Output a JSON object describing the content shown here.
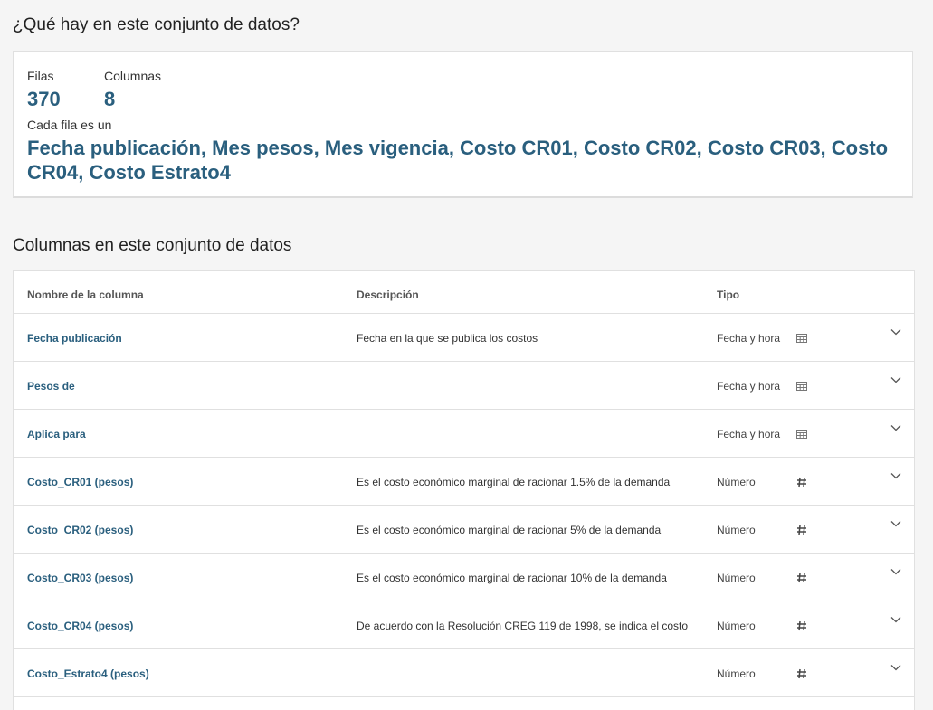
{
  "overview": {
    "title": "¿Qué hay en este conjunto de datos?",
    "rows_label": "Filas",
    "rows_value": "370",
    "columns_label": "Columnas",
    "columns_value": "8",
    "row_desc_label": "Cada fila es un",
    "row_desc_value": "Fecha publicación, Mes pesos, Mes vigencia, Costo CR01, Costo CR02, Costo CR03, Costo CR04, Costo Estrato4"
  },
  "columns_section": {
    "title": "Columnas en este conjunto de datos",
    "headers": {
      "name": "Nombre de la columna",
      "description": "Descripción",
      "type": "Tipo"
    },
    "rows": [
      {
        "name": "Fecha publicación",
        "description": "Fecha en la que se publica los costos",
        "type": "Fecha y hora",
        "icon": "calendar-icon"
      },
      {
        "name": "Pesos de",
        "description": "",
        "type": "Fecha y hora",
        "icon": "calendar-icon"
      },
      {
        "name": "Aplica para",
        "description": "",
        "type": "Fecha y hora",
        "icon": "calendar-icon"
      },
      {
        "name": "Costo_CR01 (pesos)",
        "description": "Es el costo económico marginal de racionar 1.5% de la demanda",
        "type": "Número",
        "icon": "number-icon"
      },
      {
        "name": "Costo_CR02 (pesos)",
        "description": "Es el costo económico marginal de racionar 5% de la demanda",
        "type": "Número",
        "icon": "number-icon"
      },
      {
        "name": "Costo_CR03 (pesos)",
        "description": "Es el costo económico marginal de racionar 10% de la demanda",
        "type": "Número",
        "icon": "number-icon"
      },
      {
        "name": "Costo_CR04 (pesos)",
        "description": "De acuerdo con la Resolución CREG 119 de 1998, se indica el costo",
        "type": "Número",
        "icon": "number-icon"
      },
      {
        "name": "Costo_Estrato4 (pesos)",
        "description": "",
        "type": "Número",
        "icon": "number-icon"
      }
    ]
  }
}
